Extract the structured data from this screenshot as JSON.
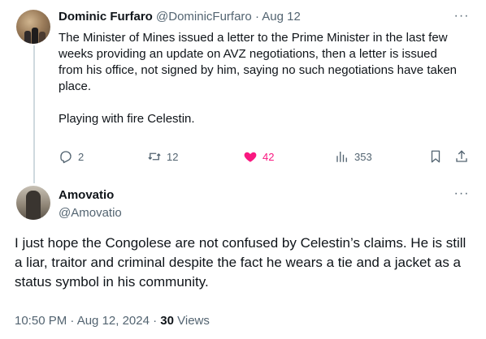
{
  "parent_tweet": {
    "display_name": "Dominic Furfaro",
    "handle": "@DominicFurfaro",
    "separator": " · ",
    "date": "Aug 12",
    "more_label": "···",
    "text": "The Minister of Mines issued a letter to the Prime Minister in the last few weeks providing an update on AVZ negotiations, then a letter is issued from his office, not signed by him, saying no such negotiations have taken place.\n\nPlaying with fire Celestin.",
    "actions": {
      "replies": "2",
      "reposts": "12",
      "likes": "42",
      "views": "353"
    },
    "icons": {
      "reply": "reply-icon",
      "repost": "repost-icon",
      "like": "heart-filled-icon",
      "views": "views-bar-chart-icon",
      "bookmark": "bookmark-icon",
      "share": "share-icon"
    },
    "colors": {
      "like_active": "#f91880",
      "muted": "#536471",
      "text": "#0f1419"
    }
  },
  "reply_tweet": {
    "display_name": "Amovatio",
    "handle": "@Amovatio",
    "more_label": "···",
    "text": "I just hope the Congolese are not confused by Celestin’s claims. He is still a liar, traitor and criminal despite the fact he wears a tie and a jacket as a status symbol in his community.",
    "timestamp": "10:50 PM · Aug 12, 2024",
    "meta_separator": " · ",
    "views_count": "30",
    "views_label": " Views"
  }
}
